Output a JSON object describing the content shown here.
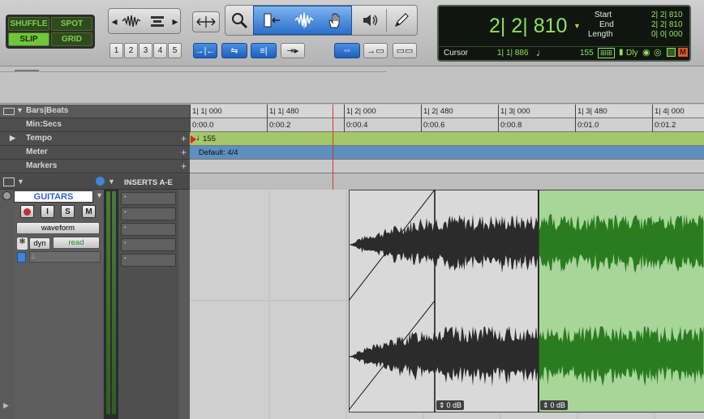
{
  "edit_modes": {
    "shuffle": "SHUFFLE",
    "spot": "SPOT",
    "slip": "SLIP",
    "grid": "GRID"
  },
  "zoom_presets": [
    "1",
    "2",
    "3",
    "4",
    "5"
  ],
  "counter": {
    "main": "2| 2| 810",
    "start_label": "Start",
    "start_value": "2| 2| 810",
    "end_label": "End",
    "end_value": "2| 2| 810",
    "length_label": "Length",
    "length_value": "0| 0| 000",
    "cursor_label": "Cursor",
    "cursor_value": "1| 1| 886",
    "tempo": "155",
    "dly_label": "Dly",
    "m_label": "M"
  },
  "rulers": {
    "bars_beats": {
      "label": "Bars|Beats",
      "ticks": [
        "1| 1| 000",
        "1| 1| 480",
        "1| 2| 000",
        "1| 2| 480",
        "1| 3| 000",
        "1| 3| 480",
        "1| 4| 000"
      ]
    },
    "min_secs": {
      "label": "Min:Secs",
      "ticks": [
        "0:00.0",
        "0:00.2",
        "0:00.4",
        "0:00.6",
        "0:00.8",
        "0:01.0",
        "0:01.2"
      ]
    },
    "tempo": {
      "label": "Tempo",
      "value": "155"
    },
    "meter": {
      "label": "Meter",
      "value": "Default: 4/4"
    },
    "markers": {
      "label": "Markers"
    }
  },
  "track_header": {
    "inserts_label": "INSERTS A-E"
  },
  "track": {
    "name": "GUITARS",
    "record": "",
    "input": "I",
    "solo": "S",
    "mute": "M",
    "view": "waveform",
    "dyn": "dyn",
    "automation": "read"
  },
  "clips": [
    {
      "gain": "0 dB"
    },
    {
      "gain": "0 dB"
    }
  ],
  "colors": {
    "counter_green": "#8fe360",
    "tempo_ruler": "#a5c76a",
    "meter_ruler": "#5e8fbe",
    "clip_green": "#a7d59a",
    "selection_blue": "#1d5fbf"
  }
}
